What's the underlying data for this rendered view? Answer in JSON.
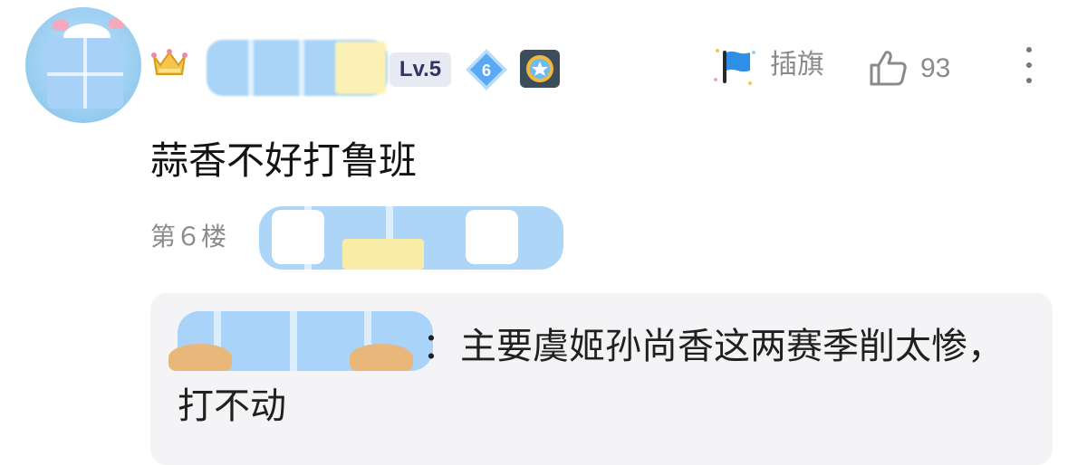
{
  "post": {
    "user_level": "Lv.5",
    "diamond_level": "6",
    "flag_label": "插旗",
    "like_count": "93",
    "comment_text": "蒜香不好打鲁班",
    "floor_label": "第６楼"
  },
  "reply": {
    "separator": "：",
    "text": "主要虞姬孙尚香这两赛季削太惨，打不动"
  },
  "colors": {
    "diamond": "#5aa9f5",
    "flag": "#2f8ee6",
    "crown": "#f0c24a"
  }
}
